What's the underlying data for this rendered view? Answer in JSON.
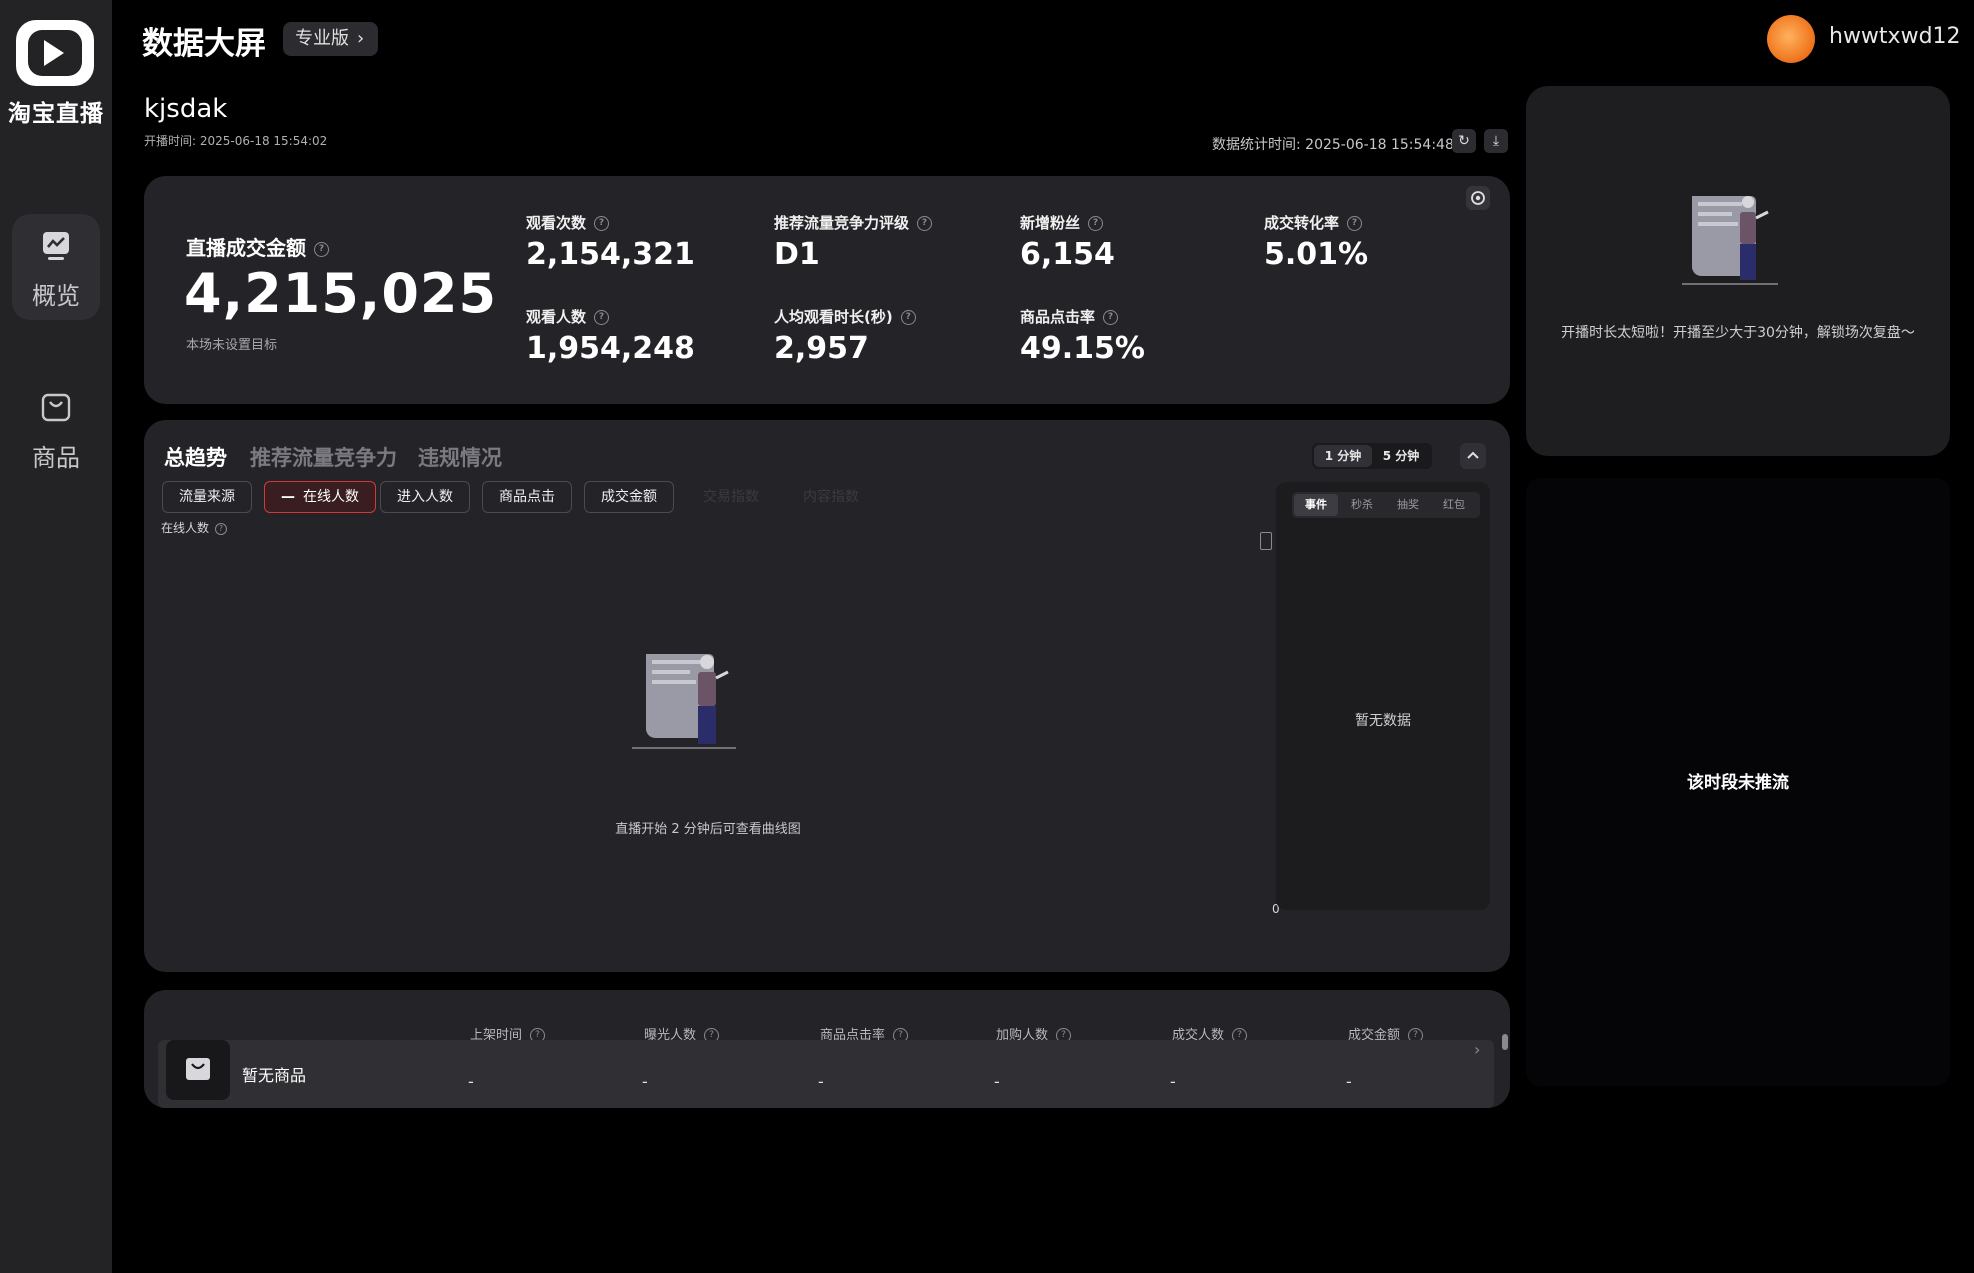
{
  "sidebar": {
    "logo_text": "淘宝直播",
    "items": [
      {
        "label": "概览",
        "icon": "chart-icon",
        "active": true
      },
      {
        "label": "商品",
        "icon": "shopping-bag-icon",
        "active": false
      }
    ]
  },
  "header": {
    "title": "数据大屏",
    "edition": "专业版",
    "username": "hwwtxwd12"
  },
  "stream": {
    "name": "kjsdak",
    "start_time": "开播时间: 2025-06-18 15:54:02",
    "stat_time": "数据统计时间: 2025-06-18 15:54:48"
  },
  "metrics": {
    "gmv_label": "直播成交金额",
    "gmv_value": "4,215,025",
    "gmv_target": "本场未设置目标",
    "items": [
      {
        "label": "观看次数",
        "value": "2,154,321"
      },
      {
        "label": "推荐流量竞争力评级",
        "value": "D1"
      },
      {
        "label": "新增粉丝",
        "value": "6,154"
      },
      {
        "label": "成交转化率",
        "value": "5.01%"
      },
      {
        "label": "观看人数",
        "value": "1,954,248"
      },
      {
        "label": "人均观看时长(秒)",
        "value": "2,957"
      },
      {
        "label": "商品点击率",
        "value": "49.15%"
      }
    ]
  },
  "trend": {
    "tabs": [
      "总趋势",
      "推荐流量竞争力",
      "违规情况"
    ],
    "active_tab": 0,
    "range": [
      "1 分钟",
      "5 分钟"
    ],
    "active_range": 0,
    "chips": [
      "流量来源",
      "在线人数",
      "进入人数",
      "商品点击",
      "成交金额",
      "交易指数",
      "内容指数"
    ],
    "active_chip": 1,
    "chart_label": "在线人数",
    "empty_text": "直播开始 2 分钟后可查看曲线图",
    "axis_zero": "0",
    "event_tabs": [
      "事件",
      "秒杀",
      "抽奖",
      "红包"
    ],
    "active_event_tab": 0,
    "event_empty": "暂无数据"
  },
  "products": {
    "columns": [
      "上架时间",
      "曝光人数",
      "商品点击率",
      "加购人数",
      "成交人数",
      "成交金额"
    ],
    "empty_label": "暂无商品",
    "row_values": [
      "-",
      "-",
      "-",
      "-",
      "-",
      "-"
    ]
  },
  "side_card": {
    "message": "开播时长太短啦！开播至少大于30分钟，解锁场次复盘～"
  },
  "push": {
    "message": "该时段未推流"
  },
  "colors": {
    "accent_red": "#d23a3a",
    "panel_bg": "#242428",
    "sidebar_bg": "#232326"
  }
}
